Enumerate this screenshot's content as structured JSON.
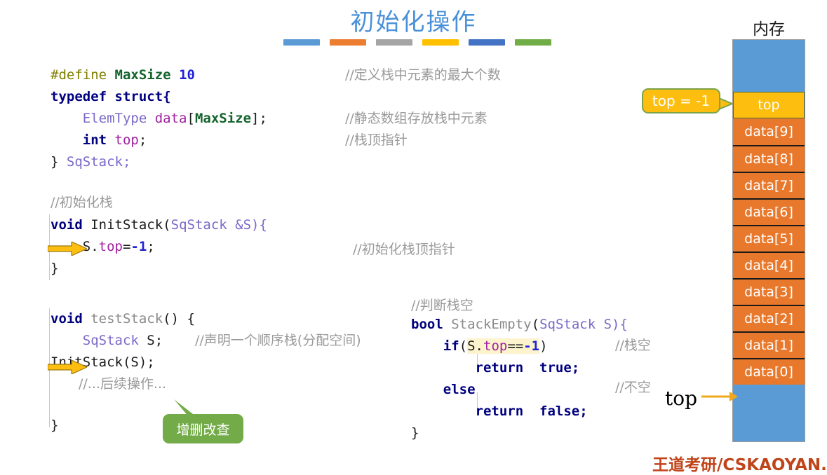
{
  "title": "初始化操作",
  "title_underline_colors": [
    "#5b9bd5",
    "#ed7d31",
    "#a5a5a5",
    "#ffc000",
    "#4472c4",
    "#70ad47"
  ],
  "colors": {
    "title": "#4a90d9",
    "keyword": "#00007f",
    "preprocessor": "#808000",
    "macro": "#15642d",
    "number": "#2121d6",
    "type": "#7b68c8",
    "member": "#a020a0",
    "comment": "#9a9a9a",
    "highlight": "#fdf3cd",
    "memory_top": "#fdbe10",
    "memory_data": "#e8792c",
    "memory_free": "#5b9bd5",
    "callout_green": "#73ab48",
    "callout_yellow": "#fdbe10",
    "arrow_yellow": "#fdbe10",
    "watermark": "#c0441a"
  },
  "code": {
    "struct_block": {
      "line1_pp": "#define",
      "line1_macro": "MaxSize",
      "line1_num": "10",
      "line2_kw1": "typedef",
      "line2_kw2": "struct",
      "line2_brace": "{",
      "line3_type": "ElemType",
      "line3_member": "data",
      "line3_lb": "[",
      "line3_macro": "MaxSize",
      "line3_rb": "];",
      "line4_kw": "int",
      "line4_member": "top",
      "line4_semi": ";",
      "line5_brace": "}",
      "line5_type": "SqStack;"
    },
    "struct_comments": [
      "//定义栈中元素的最大个数",
      "//静态数组存放栈中元素",
      "//栈顶指针"
    ],
    "init_block": {
      "comment": "//初始化栈",
      "sig_kw": "void",
      "sig_name": "InitStack",
      "sig_lp": "(",
      "sig_type": "SqStack",
      "sig_arg": "&S){",
      "body_obj": "S.",
      "body_member": "top",
      "body_eq": "=",
      "body_neg": "-",
      "body_num": "1",
      "body_semi": ";",
      "close": "}",
      "body_comment": "//初始化栈顶指针"
    },
    "test_block": {
      "sig_kw": "void",
      "sig_name": "testStack",
      "sig_rest": "() {",
      "decl_type": "SqStack",
      "decl_var": "S;",
      "decl_comment": "//声明一个顺序栈(分配空间)",
      "call": "InitStack(S);",
      "more_comment": "//...后续操作...",
      "close": "}"
    },
    "empty_block": {
      "comment": "//判断栈空",
      "sig_kw": "bool",
      "sig_name": "StackEmpty",
      "sig_lp": "(",
      "sig_type": "SqStack",
      "sig_arg": "S){",
      "if_kw": "if",
      "if_lp": "(",
      "if_obj": "S.",
      "if_member": "top",
      "if_eq": "==",
      "if_neg": "-",
      "if_num": "1",
      "if_rp": ")",
      "if_comment": "//栈空",
      "ret_kw": "return",
      "ret_true": "true;",
      "else_kw": "else",
      "else_comment": "//不空",
      "ret2_kw": "return",
      "ret2_false": "false;",
      "close": "}"
    }
  },
  "callouts": {
    "green": "增删改查",
    "yellow": "top = -1"
  },
  "memory": {
    "label": "内存",
    "top_cell": "top",
    "data_cells": [
      "data[9]",
      "data[8]",
      "data[7]",
      "data[6]",
      "data[5]",
      "data[4]",
      "data[3]",
      "data[2]",
      "data[1]",
      "data[0]"
    ],
    "pointer_label": "top"
  },
  "watermark": "王道考研/CSKAOYAN.COM"
}
